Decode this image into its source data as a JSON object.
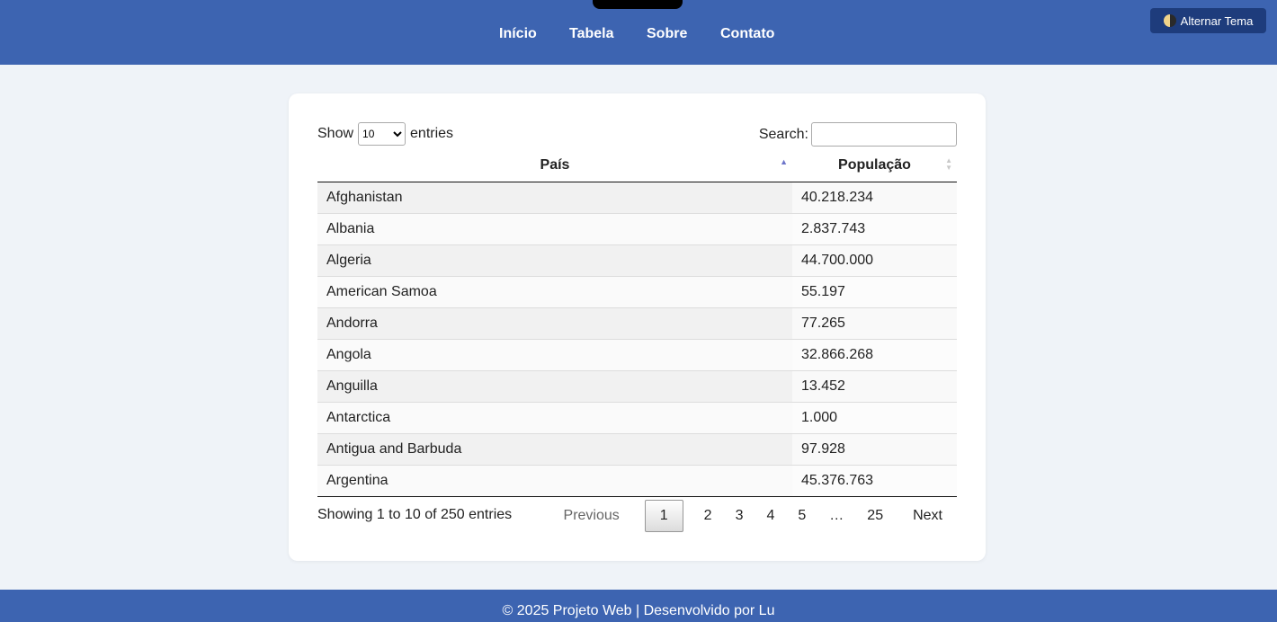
{
  "nav": {
    "items": [
      {
        "label": "Início"
      },
      {
        "label": "Tabela"
      },
      {
        "label": "Sobre"
      },
      {
        "label": "Contato"
      }
    ],
    "theme_button": "Alternar Tema"
  },
  "table_controls": {
    "show_label": "Show",
    "entries_label": "entries",
    "page_size": "10",
    "search_label": "Search:",
    "search_value": ""
  },
  "table": {
    "columns": [
      "País",
      "População"
    ],
    "rows": [
      [
        "Afghanistan",
        "40.218.234"
      ],
      [
        "Albania",
        "2.837.743"
      ],
      [
        "Algeria",
        "44.700.000"
      ],
      [
        "American Samoa",
        "55.197"
      ],
      [
        "Andorra",
        "77.265"
      ],
      [
        "Angola",
        "32.866.268"
      ],
      [
        "Anguilla",
        "13.452"
      ],
      [
        "Antarctica",
        "1.000"
      ],
      [
        "Antigua and Barbuda",
        "97.928"
      ],
      [
        "Argentina",
        "45.376.763"
      ]
    ]
  },
  "pagination": {
    "info": "Showing 1 to 10 of 250 entries",
    "previous": "Previous",
    "pages": [
      "1",
      "2",
      "3",
      "4",
      "5"
    ],
    "ellipsis": "…",
    "last_page": "25",
    "next": "Next",
    "current": "1"
  },
  "footer": {
    "text": "© 2025 Projeto Web | Desenvolvido por Lu"
  },
  "colors": {
    "header_bg": "#3d64b1",
    "theme_button_bg": "#1e3c7c",
    "page_bg": "#eff3f8"
  }
}
